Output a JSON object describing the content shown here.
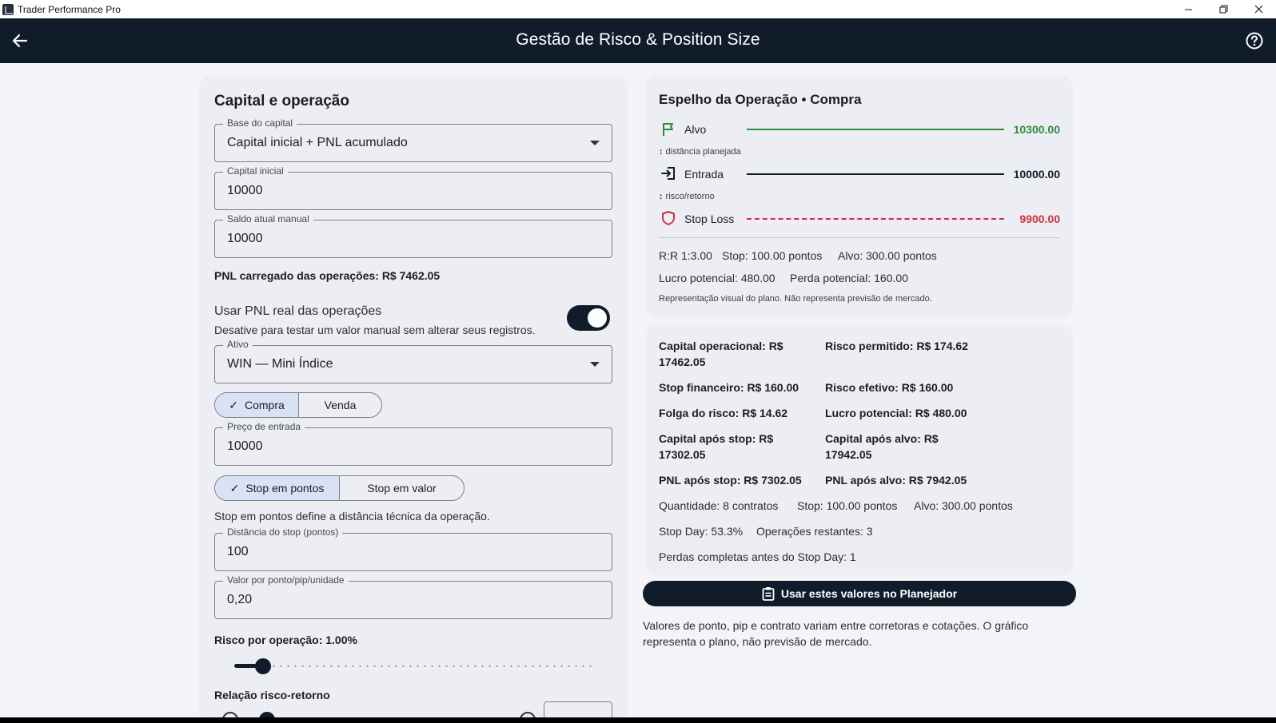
{
  "window": {
    "title": "Trader Performance Pro",
    "minimize": "—",
    "maximize": "❐",
    "close": "✕"
  },
  "header": {
    "title": "Gestão de Risco & Position Size"
  },
  "left": {
    "section_title": "Capital e operação",
    "base_capital": {
      "label": "Base do capital",
      "value": "Capital inicial + PNL acumulado"
    },
    "capital_inicial": {
      "label": "Capital inicial",
      "value": "10000"
    },
    "saldo_manual": {
      "label": "Saldo atual manual",
      "value": "10000"
    },
    "pnl_loaded": "PNL carregado das operações: R$ 7462.05",
    "use_pnl": {
      "title": "Usar PNL real das operações",
      "subtitle": "Desative para testar um valor manual sem alterar seus registros.",
      "on": true
    },
    "ativo": {
      "label": "Ativo",
      "value": "WIN — Mini Índice"
    },
    "side": {
      "options": [
        "Compra",
        "Venda"
      ],
      "selected": "Compra"
    },
    "preco_entrada": {
      "label": "Preço de entrada",
      "value": "10000"
    },
    "stop_mode": {
      "options": [
        "Stop em pontos",
        "Stop em valor"
      ],
      "selected": "Stop em pontos"
    },
    "stop_mode_hint": "Stop em pontos define a distância técnica da operação.",
    "distancia_stop": {
      "label": "Distância do stop (pontos)",
      "value": "100"
    },
    "valor_ponto": {
      "label": "Valor por ponto/pip/unidade",
      "value": "0,20"
    },
    "risco": {
      "label": "Risco por operação: 1.00%",
      "value_percent": 1.0
    },
    "relacao": {
      "label": "Relação risco-retorno"
    }
  },
  "mirror": {
    "title": "Espelho da Operação • Compra",
    "alvo": {
      "label": "Alvo",
      "value": "10300.00",
      "color": "#2e8b3e"
    },
    "dist_planejada": "↕ distância planejada",
    "entrada": {
      "label": "Entrada",
      "value": "10000.00",
      "color": "#111c2b"
    },
    "risco_retorno": "↕ risco/retorno",
    "stop": {
      "label": "Stop Loss",
      "value": "9900.00",
      "color": "#d32f3a"
    },
    "stats1": [
      "R:R 1:3.00",
      "Stop: 100.00 pontos",
      "Alvo: 300.00 pontos"
    ],
    "stats2": [
      "Lucro potencial: 480.00",
      "Perda potencial: 160.00"
    ],
    "note": "Representação visual do plano. Não representa previsão de mercado."
  },
  "metrics": {
    "capital_operacional": "Capital operacional: R$ 17462.05",
    "risco_permitido": "Risco permitido: R$ 174.62",
    "stop_financeiro": "Stop financeiro: R$ 160.00",
    "risco_efetivo": "Risco efetivo: R$ 160.00",
    "folga_risco": "Folga do risco: R$ 14.62",
    "lucro_potencial": "Lucro potencial: R$ 480.00",
    "capital_apos_stop": "Capital após stop: R$ 17302.05",
    "capital_apos_alvo": "Capital após alvo: R$ 17942.05",
    "pnl_apos_stop": "PNL após stop: R$ 7302.05",
    "pnl_apos_alvo": "PNL após alvo: R$ 7942.05",
    "quantidade": [
      "Quantidade: 8 contratos",
      "Stop: 100.00 pontos",
      "Alvo: 300.00 pontos"
    ],
    "stop_day": [
      "Stop Day: 53.3%",
      "Operações restantes: 3"
    ],
    "perdas": "Perdas completas antes do Stop Day: 1"
  },
  "actions": {
    "use_planner": "Usar estes valores no Planejador",
    "footer": "Valores de ponto, pip e contrato variam entre corretoras e cotações. O gráfico representa o plano, não previsão de mercado."
  }
}
